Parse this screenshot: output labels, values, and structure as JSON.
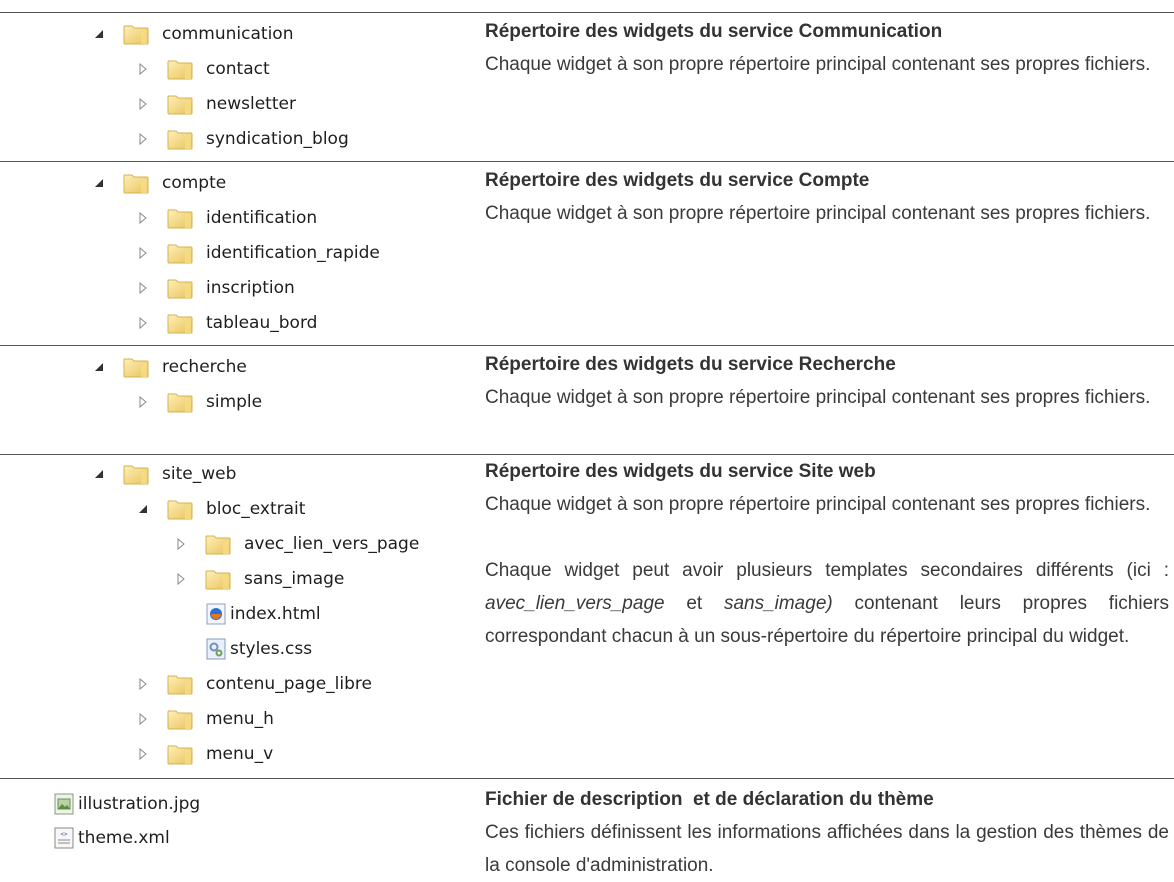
{
  "sections": [
    {
      "title": "Répertoire des widgets du service Communication",
      "body": "Chaque widget à son propre répertoire principal contenant ses propres fichiers.",
      "tree": {
        "root": "communication",
        "children": [
          "contact",
          "newsletter",
          "syndication_blog"
        ]
      }
    },
    {
      "title": "Répertoire des widgets du service Compte",
      "body": "Chaque widget à son propre répertoire principal contenant ses propres fichiers.",
      "tree": {
        "root": "compte",
        "children": [
          "identification",
          "identification_rapide",
          "inscription",
          "tableau_bord"
        ]
      }
    },
    {
      "title": "Répertoire des widgets du service Recherche",
      "body": "Chaque widget à son propre répertoire principal contenant ses propres fichiers.",
      "tree": {
        "root": "recherche",
        "children": [
          "simple"
        ]
      }
    },
    {
      "title": "Répertoire des widgets du service Site web",
      "body": "Chaque widget à son propre répertoire principal contenant ses propres fichiers.",
      "body2_prefix": "Chaque widget peut avoir plusieurs templates secondaires différents (ici : ",
      "body2_em1": "avec_lien_vers_page",
      "body2_mid": " et ",
      "body2_em2": "sans_image)",
      "body2_suffix": " contenant leurs propres fichiers correspondant chacun à un sous-répertoire du répertoire principal du widget.",
      "tree": {
        "root": "site_web",
        "sub": "bloc_extrait",
        "sub_children": [
          "avec_lien_vers_page",
          "sans_image"
        ],
        "files": [
          "index.html",
          "styles.css"
        ],
        "children": [
          "contenu_page_libre",
          "menu_h",
          "menu_v"
        ]
      }
    },
    {
      "title": "Fichier de description  et de déclaration du thème",
      "body": "Ces fichiers définissent les informations affichées dans la gestion des thèmes de la console d'administration.",
      "files": [
        "illustration.jpg",
        "theme.xml"
      ]
    }
  ],
  "icons": {
    "expanded": "expanded-triangle-icon",
    "collapsed": "collapsed-triangle-icon",
    "folder": "folder-icon",
    "html": "html-file-icon",
    "css": "css-file-icon",
    "image": "image-file-icon",
    "xml": "xml-file-icon"
  },
  "colors": {
    "folder": "#f2cf6b",
    "folder_light": "#fbe9a9",
    "divider": "#555555",
    "text": "#333333"
  }
}
